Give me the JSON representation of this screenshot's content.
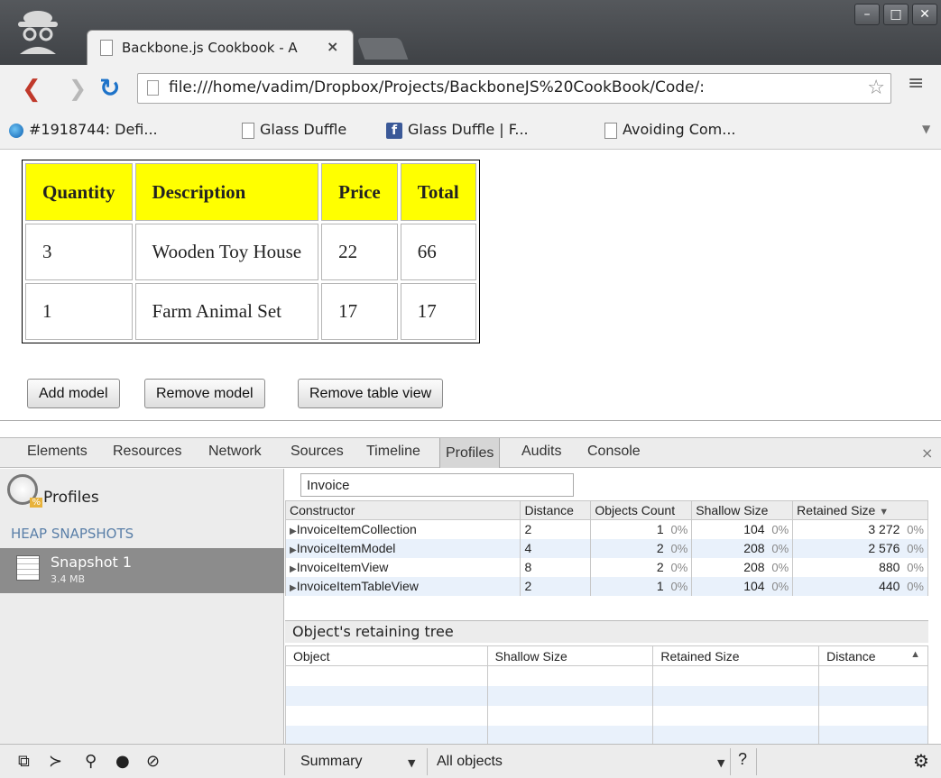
{
  "browser": {
    "tab_title": "Backbone.js Cookbook - A",
    "tab_close": "×",
    "window_buttons": [
      "–",
      "□",
      "✕"
    ],
    "url": "file:///home/vadim/Dropbox/Projects/BackboneJS%20CookBook/Code/:",
    "bookmarks": [
      {
        "label": "#1918744: Defi...",
        "icon": "firefox-icon"
      },
      {
        "label": "Glass Duffle",
        "icon": "page-icon"
      },
      {
        "label": "Glass Duffle | F...",
        "icon": "facebook-icon"
      },
      {
        "label": "Avoiding Com...",
        "icon": "page-icon"
      }
    ]
  },
  "invoice": {
    "headers": [
      "Quantity",
      "Description",
      "Price",
      "Total"
    ],
    "rows": [
      [
        "3",
        "Wooden Toy House",
        "22",
        "66"
      ],
      [
        "1",
        "Farm Animal Set",
        "17",
        "17"
      ]
    ],
    "header_color": "#ffff00"
  },
  "buttons": {
    "add": "Add model",
    "remove": "Remove model",
    "remove_table": "Remove table view"
  },
  "devtools": {
    "tabs": [
      "Elements",
      "Resources",
      "Network",
      "Sources",
      "Timeline",
      "Profiles",
      "Audits",
      "Console"
    ],
    "active_tab": "Profiles",
    "close": "×",
    "sidebar": {
      "title": "Profiles",
      "section": "HEAP SNAPSHOTS",
      "snapshot_name": "Snapshot 1",
      "snapshot_size": "3.4 MB"
    },
    "filter_value": "Invoice",
    "columns": [
      "Constructor",
      "Distance",
      "Objects Count",
      "Shallow Size",
      "Retained Size"
    ],
    "sort_indicator": "▼",
    "rows": [
      {
        "name": "InvoiceItemCollection",
        "distance": "2",
        "count": "1",
        "count_pct": "0%",
        "shallow": "104",
        "shallow_pct": "0%",
        "retained": "3 272",
        "retained_pct": "0%"
      },
      {
        "name": "InvoiceItemModel",
        "distance": "4",
        "count": "2",
        "count_pct": "0%",
        "shallow": "208",
        "shallow_pct": "0%",
        "retained": "2 576",
        "retained_pct": "0%"
      },
      {
        "name": "InvoiceItemView",
        "distance": "8",
        "count": "2",
        "count_pct": "0%",
        "shallow": "208",
        "shallow_pct": "0%",
        "retained": "880",
        "retained_pct": "0%"
      },
      {
        "name": "InvoiceItemTableView",
        "distance": "2",
        "count": "1",
        "count_pct": "0%",
        "shallow": "104",
        "shallow_pct": "0%",
        "retained": "440",
        "retained_pct": "0%"
      }
    ],
    "retaining_title": "Object's retaining tree",
    "retaining_columns": [
      "Object",
      "Shallow Size",
      "Retained Size",
      "Distance"
    ],
    "retaining_sort": "▲",
    "status": {
      "view": "Summary",
      "filter": "All objects",
      "help": "?"
    }
  }
}
